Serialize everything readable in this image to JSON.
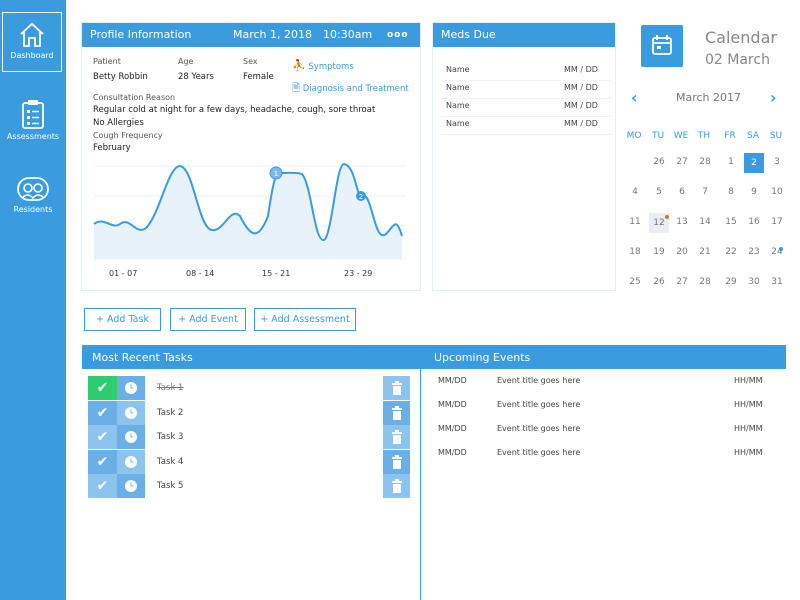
{
  "sidebar": {
    "items": [
      {
        "label": "Dashboard"
      },
      {
        "label": "Assessments"
      },
      {
        "label": "Residents"
      }
    ]
  },
  "profile": {
    "title": "Profile Information",
    "date": "March 1, 2018",
    "time": "10:30am",
    "more": "ooo",
    "patient_label": "Patient",
    "patient": "Betty Robbin",
    "age_label": "Age",
    "age": "28 Years",
    "sex_label": "Sex",
    "sex": "Female",
    "symptoms_link": "Symptoms",
    "diagnosis_link": "Diagnosis and Treatment",
    "reason_label": "Consultation Reason",
    "reason": "Regular cold at night for a few days, headache, cough, sore throat",
    "allergies": "No Allergies",
    "cough_label": "Cough Frequency",
    "cough_month": "February",
    "chart": {
      "x_ticks": [
        "01 - 07",
        "08 - 14",
        "15 - 21",
        "23 - 29"
      ],
      "markers": [
        "1",
        "2"
      ]
    }
  },
  "meds": {
    "title": "Meds Due",
    "rows": [
      {
        "name": "Name",
        "date": "MM / DD"
      },
      {
        "name": "Name",
        "date": "MM / DD"
      },
      {
        "name": "Name",
        "date": "MM / DD"
      },
      {
        "name": "Name",
        "date": "MM / DD"
      }
    ]
  },
  "calendar": {
    "title": "Calendar",
    "date": "02 March",
    "month": "March 2017",
    "prev": "‹",
    "next": "›",
    "dow": [
      "MO",
      "TU",
      "WE",
      "TH",
      "FR",
      "SA",
      "SU"
    ],
    "weeks": [
      [
        "26",
        "27",
        "28",
        "1",
        "2",
        "3"
      ],
      [
        "4",
        "5",
        "6",
        "7",
        "8",
        "9",
        "10"
      ],
      [
        "11",
        "12",
        "13",
        "14",
        "15",
        "16",
        "17"
      ],
      [
        "18",
        "19",
        "20",
        "21",
        "22",
        "23",
        "24"
      ],
      [
        "25",
        "26",
        "27",
        "28",
        "29",
        "30",
        "31"
      ]
    ],
    "accent": "#3a9bde"
  },
  "actions": {
    "add_task": "+ Add Task",
    "add_event": "+ Add Event",
    "add_assessment": "+ Add Assessment"
  },
  "tasks": {
    "title": "Most Recent Tasks",
    "items": [
      {
        "label": "Task 1",
        "done": true
      },
      {
        "label": "Task 2",
        "done": false
      },
      {
        "label": "Task 3",
        "done": false
      },
      {
        "label": "Task 4",
        "done": false
      },
      {
        "label": "Task 5",
        "done": false
      }
    ]
  },
  "events": {
    "title": "Upcoming Events",
    "items": [
      {
        "date": "MM/DD",
        "title": "Event title goes here",
        "time": "HH/MM"
      },
      {
        "date": "MM/DD",
        "title": "Event title goes here",
        "time": "HH/MM"
      },
      {
        "date": "MM/DD",
        "title": "Event title goes here",
        "time": "HH/MM"
      },
      {
        "date": "MM/DD",
        "title": "Event title goes here",
        "time": "HH/MM"
      }
    ]
  },
  "colors": {
    "primary": "#3a9bde",
    "done": "#2ecc71",
    "light_blue": "#8cc4ee",
    "mid_blue": "#6ab0e6"
  }
}
